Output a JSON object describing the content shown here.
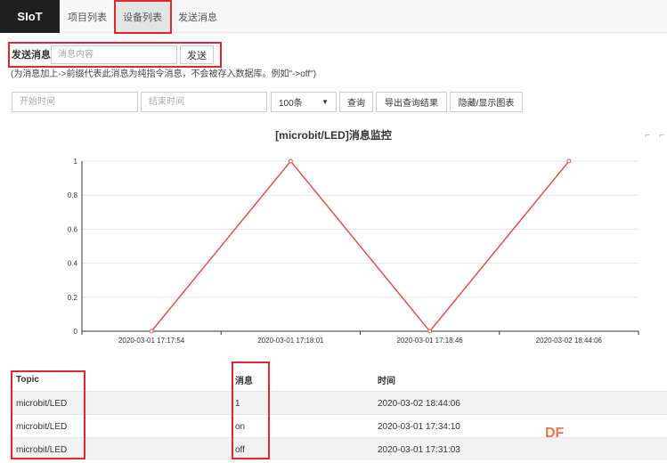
{
  "nav": {
    "brand": "SIoT",
    "items": [
      "项目列表",
      "设备列表",
      "发送消息"
    ]
  },
  "send": {
    "label": "发送消息",
    "placeholder": "消息内容",
    "button": "发送",
    "hint": "(为消息加上->前缀代表此消息为纯指令消息，不会被存入数据库。例如\"->off\")"
  },
  "query": {
    "start_placeholder": "开始时间",
    "end_placeholder": "结束时间",
    "limit_value": "100条",
    "search_button": "查询",
    "export_button": "导出查询结果",
    "toggle_chart_button": "隐藏/显示图表"
  },
  "chart_data": {
    "type": "line",
    "title": "[microbit/LED]消息监控",
    "x": [
      "2020-03-01 17:17:54",
      "2020-03-01 17:18:01",
      "2020-03-01 17:18:46",
      "2020-03-02 18:44:06"
    ],
    "series": [
      {
        "values": [
          0,
          1,
          0,
          1
        ]
      }
    ],
    "ylim": [
      0,
      1
    ],
    "yticks": [
      "0",
      "0.2",
      "0.4",
      "0.6",
      "0.8",
      "1"
    ],
    "grid": true,
    "line_color": "#d9534f"
  },
  "table": {
    "headers": [
      "Topic",
      "消息",
      "时间"
    ],
    "rows": [
      [
        "microbit/LED",
        "1",
        "2020-03-02 18:44:06"
      ],
      [
        "microbit/LED",
        "on",
        "2020-03-01 17:34:10"
      ],
      [
        "microbit/LED",
        "off",
        "2020-03-01 17:31:03"
      ]
    ]
  },
  "watermark": "DF",
  "colors": {
    "highlight": "#e0262e",
    "nav_bg": "#1f1f1f"
  }
}
